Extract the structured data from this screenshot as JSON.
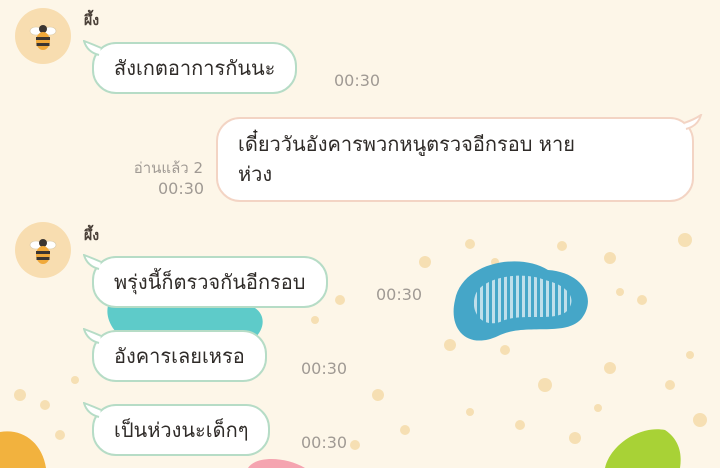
{
  "chat": {
    "messages": [
      {
        "sender": "ผึ้ง",
        "text": "สังเกตอาการกันนะ",
        "time": "00:30"
      },
      {
        "text": "เดี๋ยววันอังคารพวกหนูตรวจอีกรอบ หายห่วง",
        "line1": "เดี๋ยววันอังคารพวกหนูตรวจอีกรอบ หาย",
        "line2": "ห่วง",
        "read": "อ่านแล้ว 2",
        "time": "00:30"
      },
      {
        "sender": "ผึ้ง",
        "text": "พรุ่งนี้ก็ตรวจกันอีกรอบ",
        "time": "00:30"
      },
      {
        "text": "อังคารเลยเหรอ",
        "time": "00:30"
      },
      {
        "text": "เป็นห่วงนะเด็กๆ",
        "time": "00:30"
      }
    ]
  },
  "colors": {
    "background": "#fdf6e8",
    "incoming_border": "#b6dcc6",
    "outgoing_border": "#f3d4c4",
    "avatar_bg": "#f8ddb0",
    "timestamp": "#a09a94"
  },
  "icons": {
    "avatar": "bee-icon"
  }
}
